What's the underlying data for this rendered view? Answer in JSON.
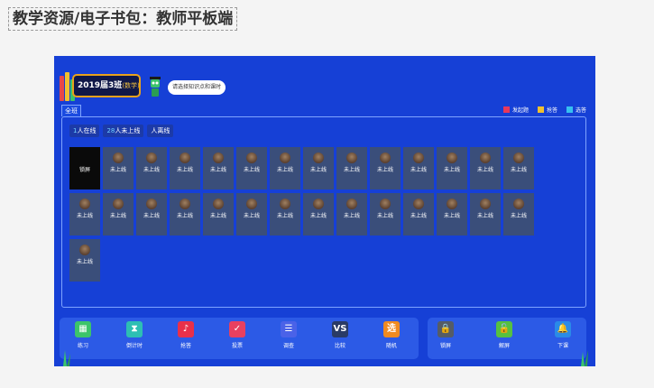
{
  "slide_title": "教学资源/电子书包：教师平板端",
  "header": {
    "class_name": "2019届3班",
    "subject": "(数学)",
    "prompt": "请选择知识点和课时"
  },
  "tab_all": "全班",
  "legend": [
    {
      "label": "发起题",
      "color": "#e8385c"
    },
    {
      "label": "抢答",
      "color": "#f0c030"
    },
    {
      "label": "选答",
      "color": "#36c0f0"
    }
  ],
  "status": {
    "online_count": "1",
    "online_label": "人在线",
    "offline_count": "28",
    "offline_label": "人未上线",
    "left_label": "人离线"
  },
  "students": [
    {
      "label": "锁屏",
      "state": "active"
    },
    {
      "label": "未上线"
    },
    {
      "label": "未上线"
    },
    {
      "label": "未上线"
    },
    {
      "label": "未上线"
    },
    {
      "label": "未上线"
    },
    {
      "label": "未上线"
    },
    {
      "label": "未上线"
    },
    {
      "label": "未上线"
    },
    {
      "label": "未上线"
    },
    {
      "label": "未上线"
    },
    {
      "label": "未上线"
    },
    {
      "label": "未上线"
    },
    {
      "label": "未上线"
    },
    {
      "label": "未上线"
    },
    {
      "label": "未上线"
    },
    {
      "label": "未上线"
    },
    {
      "label": "未上线"
    },
    {
      "label": "未上线"
    },
    {
      "label": "未上线"
    },
    {
      "label": "未上线"
    },
    {
      "label": "未上线"
    },
    {
      "label": "未上线"
    },
    {
      "label": "未上线"
    },
    {
      "label": "未上线"
    },
    {
      "label": "未上线"
    },
    {
      "label": "未上线"
    },
    {
      "label": "未上线"
    },
    {
      "label": "未上线"
    }
  ],
  "tools_left": [
    {
      "label": "练习",
      "icon": "grid-icon",
      "glyph": "▦",
      "color": "#3cc46a"
    },
    {
      "label": "倒计时",
      "icon": "hourglass-icon",
      "glyph": "⧗",
      "color": "#2dbfb3"
    },
    {
      "label": "抢答",
      "icon": "bell-icon",
      "glyph": "♪",
      "color": "#e8304a"
    },
    {
      "label": "投票",
      "icon": "vote-icon",
      "glyph": "✓",
      "color": "#e84060"
    },
    {
      "label": "调查",
      "icon": "survey-icon",
      "glyph": "☰",
      "color": "#4a62e8"
    },
    {
      "label": "比较",
      "icon": "compare-icon",
      "glyph": "VS",
      "color": "#2a3b66"
    },
    {
      "label": "随机",
      "icon": "random-icon",
      "glyph": "选",
      "color": "#f08a20"
    }
  ],
  "tools_right": [
    {
      "label": "锁屏",
      "icon": "lock-icon",
      "glyph": "🔒",
      "color": "#555c66"
    },
    {
      "label": "解屏",
      "icon": "unlock-icon",
      "glyph": "🔓",
      "color": "#56c040"
    },
    {
      "label": "下课",
      "icon": "class-bell-icon",
      "glyph": "🔔",
      "color": "#2a8ae8"
    }
  ]
}
